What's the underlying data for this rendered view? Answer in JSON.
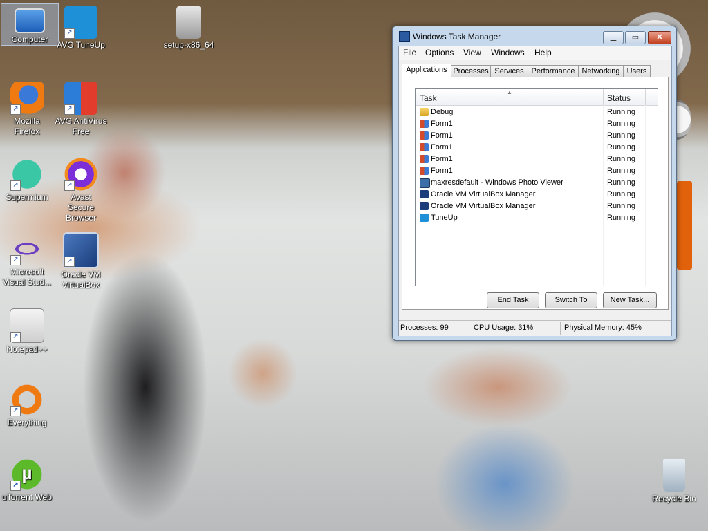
{
  "desktop_icons": [
    {
      "label": "Computer",
      "icon": "computer-icon"
    },
    {
      "label": "AVG TuneUp",
      "icon": "avg-tuneup-icon"
    },
    {
      "label": "setup-x86_64",
      "icon": "setup-installer-icon"
    },
    {
      "label": "Mozilla Firefox",
      "icon": "firefox-icon"
    },
    {
      "label": "AVG AntiVirus Free",
      "icon": "avg-antivirus-icon"
    },
    {
      "label": "Supermium",
      "icon": "supermium-icon"
    },
    {
      "label": "Avast Secure Browser",
      "icon": "avast-browser-icon"
    },
    {
      "label": "Microsoft Visual Stud...",
      "icon": "visual-studio-icon"
    },
    {
      "label": "Oracle VM VirtualBox",
      "icon": "virtualbox-icon"
    },
    {
      "label": "Notepad++",
      "icon": "notepad-plus-plus-icon"
    },
    {
      "label": "Everything",
      "icon": "everything-search-icon"
    },
    {
      "label": "uTorrent Web",
      "icon": "utorrent-icon"
    },
    {
      "label": "Recycle Bin",
      "icon": "recycle-bin-icon"
    }
  ],
  "task_manager": {
    "title": "Windows Task Manager",
    "caption_buttons": {
      "minimize": "▁",
      "maximize": "▭",
      "close": "✕"
    },
    "menu": [
      "File",
      "Options",
      "View",
      "Windows",
      "Help"
    ],
    "tabs": [
      "Applications",
      "Processes",
      "Services",
      "Performance",
      "Networking",
      "Users"
    ],
    "active_tab": "Applications",
    "columns": {
      "task": "Task",
      "status": "Status"
    },
    "rows": [
      {
        "task": "Debug",
        "status": "Running",
        "icon": "folder-icon"
      },
      {
        "task": "Form1",
        "status": "Running",
        "icon": "form-app-icon"
      },
      {
        "task": "Form1",
        "status": "Running",
        "icon": "form-app-icon"
      },
      {
        "task": "Form1",
        "status": "Running",
        "icon": "form-app-icon"
      },
      {
        "task": "Form1",
        "status": "Running",
        "icon": "form-app-icon"
      },
      {
        "task": "Form1",
        "status": "Running",
        "icon": "form-app-icon"
      },
      {
        "task": "maxresdefault - Windows Photo Viewer",
        "status": "Running",
        "icon": "photo-viewer-icon"
      },
      {
        "task": "Oracle VM VirtualBox Manager",
        "status": "Running",
        "icon": "virtualbox-icon"
      },
      {
        "task": "Oracle VM VirtualBox Manager",
        "status": "Running",
        "icon": "virtualbox-icon"
      },
      {
        "task": "TuneUp",
        "status": "Running",
        "icon": "tuneup-icon"
      }
    ],
    "buttons": {
      "end_task": "End Task",
      "switch_to": "Switch To",
      "new_task": "New Task..."
    },
    "status": {
      "processes": "Processes: 99",
      "cpu": "CPU Usage: 31%",
      "memory": "Physical Memory: 45%"
    }
  },
  "colors": {
    "accent": "#2c5aa0",
    "close_button": "#c2401f",
    "window_frame": "#c6d8ec"
  }
}
